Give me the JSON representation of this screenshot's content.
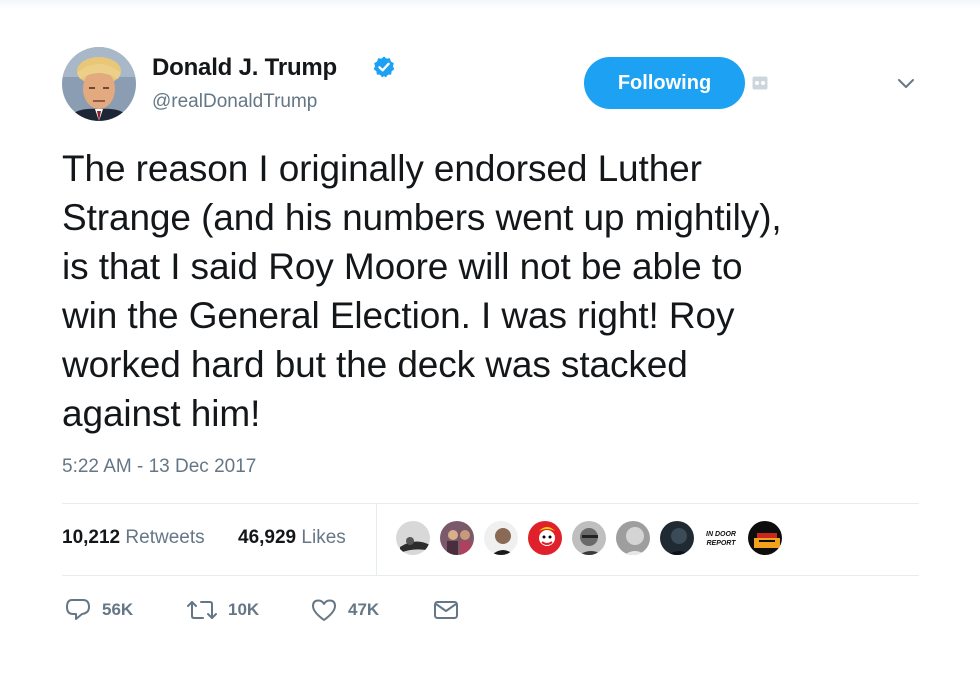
{
  "author": {
    "name": "Donald J. Trump",
    "handle": "@realDonaldTrump",
    "verified": true,
    "avatar_icon": "profile-photo"
  },
  "follow_button": {
    "label": "Following"
  },
  "tweet": {
    "text": "The reason I originally endorsed Luther\nStrange (and his numbers went up mightily),\nis that I said Roy Moore will not be able to\nwin the General Election.  I was right! Roy\nworked hard but the deck was stacked\nagainst him!",
    "timestamp": "5:22 AM - 13 Dec 2017"
  },
  "stats": {
    "retweets_count": "10,212",
    "retweets_label": "Retweets",
    "likes_count": "46,929",
    "likes_label": "Likes"
  },
  "likers": [
    {
      "icon": "liker-avatar-1"
    },
    {
      "icon": "liker-avatar-2"
    },
    {
      "icon": "liker-avatar-3"
    },
    {
      "icon": "liker-avatar-4"
    },
    {
      "icon": "liker-avatar-5"
    },
    {
      "icon": "liker-avatar-6"
    },
    {
      "icon": "liker-avatar-7"
    },
    {
      "icon": "liker-avatar-8",
      "text": "IN DOOR REPORT"
    },
    {
      "icon": "liker-avatar-9"
    }
  ],
  "actions": {
    "reply_count": "56K",
    "retweet_count": "10K",
    "like_count": "47K"
  },
  "colors": {
    "accent": "#1da1f2",
    "text": "#14171a",
    "secondary": "#657786",
    "divider": "#e6ecf0"
  }
}
